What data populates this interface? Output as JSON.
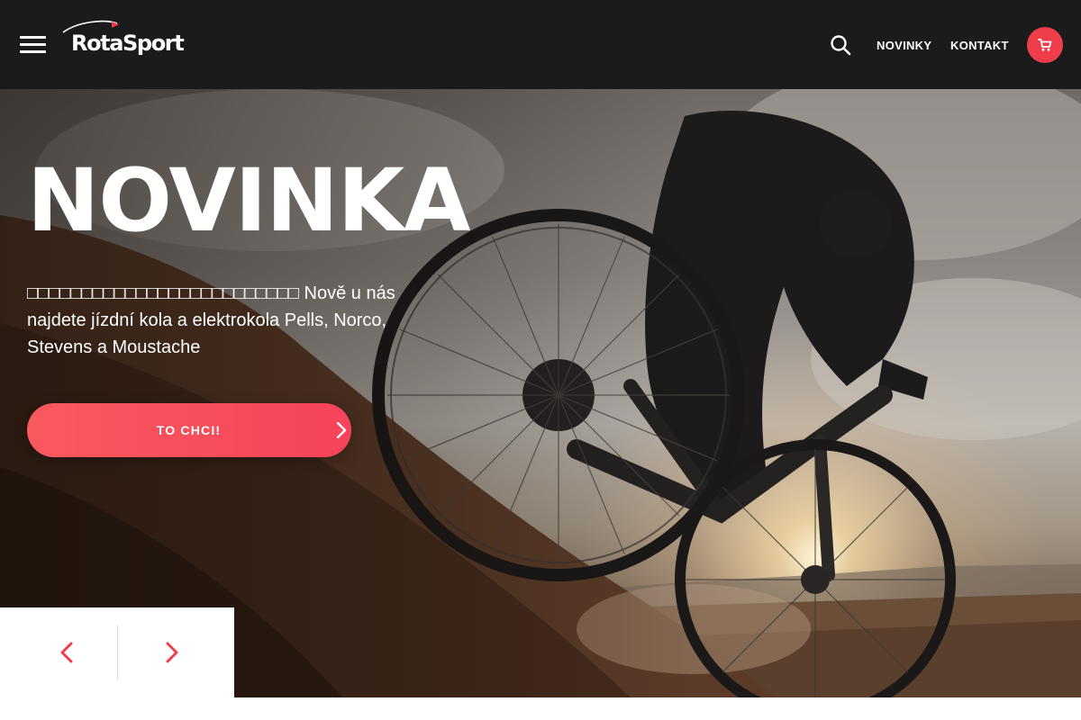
{
  "brand": {
    "name": "RotaSport",
    "accent": "#ef3e4a",
    "header_bg": "#1b1b1b"
  },
  "header": {
    "nav": [
      {
        "label": "NOVINKY"
      },
      {
        "label": "KONTAKT"
      }
    ],
    "icons": [
      "menu-icon",
      "search-icon",
      "cart-icon"
    ]
  },
  "hero": {
    "title": "NOVINKA",
    "text": "□□□□□□□□□□□□□□□□□□□□□□□□□ Nově u nás najdete jízdní kola a elektrokola Pells, Norco, Stevens a Moustache",
    "cta_label": "TO CHCI!",
    "cta_gradient": [
      "#f85a5e",
      "#f6435a"
    ]
  },
  "slider": {
    "icons": [
      "chevron-left-icon",
      "chevron-right-icon"
    ]
  }
}
